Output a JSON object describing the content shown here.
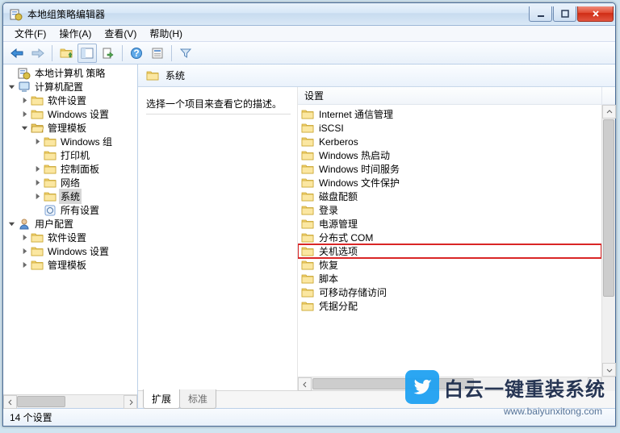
{
  "window": {
    "title": "本地组策略编辑器"
  },
  "menu": {
    "file": "文件(F)",
    "action": "操作(A)",
    "view": "查看(V)",
    "help": "帮助(H)"
  },
  "tree": {
    "root": "本地计算机 策略",
    "computer": "计算机配置",
    "software": "软件设置",
    "windows": "Windows 设置",
    "admin": "管理模板",
    "wincomp": "Windows 组",
    "printer": "打印机",
    "control": "控制面板",
    "network": "网络",
    "system": "系统",
    "allset": "所有设置",
    "user": "用户配置",
    "usoftware": "软件设置",
    "uwindows": "Windows 设置",
    "uadmin": "管理模板"
  },
  "addr": {
    "title": "系统"
  },
  "desc": {
    "prompt": "选择一个项目来查看它的描述。"
  },
  "columns": {
    "setting": "设置"
  },
  "items": [
    "Internet 通信管理",
    "iSCSI",
    "Kerberos",
    "Windows 热启动",
    "Windows 时间服务",
    "Windows 文件保护",
    "磁盘配额",
    "登录",
    "电源管理",
    "分布式 COM",
    "关机选项",
    "恢复",
    "脚本",
    "可移动存储访问",
    "凭据分配"
  ],
  "highlight_index": 10,
  "tabs": {
    "ext": "扩展",
    "std": "标准"
  },
  "status": {
    "count": "14 个设置"
  },
  "watermark": {
    "text": "白云一键重装系统",
    "url": "www.baiyunxitong.com"
  }
}
